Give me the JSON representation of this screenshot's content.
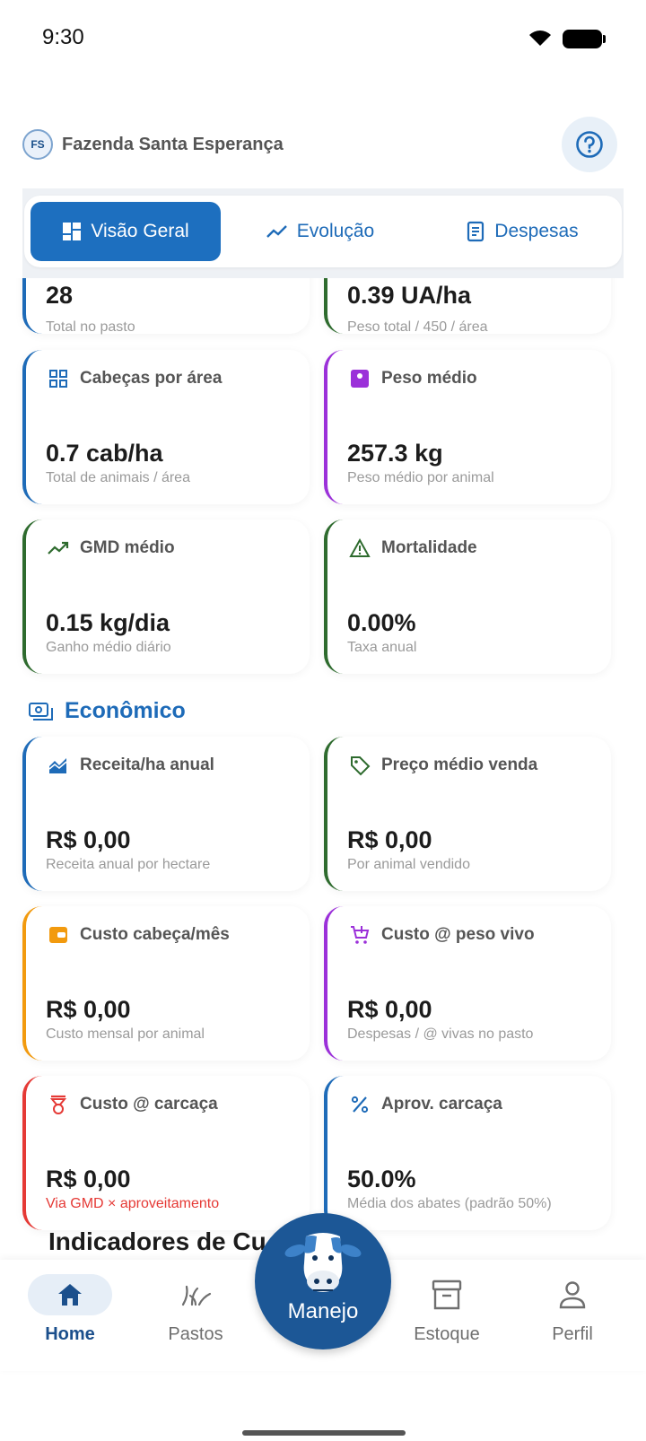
{
  "status_bar": {
    "time": "9:30"
  },
  "header": {
    "avatar_initials": "FS",
    "farm_name": "Fazenda Santa Esperança"
  },
  "tabs": [
    {
      "label": "Visão Geral",
      "icon": "dashboard-icon",
      "active": true
    },
    {
      "label": "Evolução",
      "icon": "trending-up-icon",
      "active": false
    },
    {
      "label": "Despesas",
      "icon": "receipt-icon",
      "active": false
    }
  ],
  "cards": {
    "total_pasto": {
      "value": "28",
      "subtitle": "Total no pasto",
      "accent": "#1e6bb8"
    },
    "lotacao": {
      "value": "0.39 UA/ha",
      "subtitle": "Peso total / 450 / área",
      "accent": "#2e6b2e"
    },
    "cabecas_area": {
      "title": "Cabeças por área",
      "value": "0.7 cab/ha",
      "subtitle": "Total de animais / área",
      "accent": "#1e6bb8"
    },
    "peso_medio": {
      "title": "Peso médio",
      "value": "257.3 kg",
      "subtitle": "Peso médio por animal",
      "accent": "#9b30d9"
    },
    "gmd_medio": {
      "title": "GMD médio",
      "value": "0.15 kg/dia",
      "subtitle": "Ganho médio diário",
      "accent": "#2e6b2e"
    },
    "mortalidade": {
      "title": "Mortalidade",
      "value": "0.00%",
      "subtitle": "Taxa anual",
      "accent": "#2e6b2e"
    },
    "receita_ha": {
      "title": "Receita/ha anual",
      "value": "R$ 0,00",
      "subtitle": "Receita anual por hectare",
      "accent": "#1e6bb8"
    },
    "preco_medio": {
      "title": "Preço médio venda",
      "value": "R$ 0,00",
      "subtitle": "Por animal vendido",
      "accent": "#2e6b2e"
    },
    "custo_cabeca": {
      "title": "Custo cabeça/mês",
      "value": "R$ 0,00",
      "subtitle": "Custo mensal por animal",
      "accent": "#f29a0e"
    },
    "custo_peso_vivo": {
      "title": "Custo @ peso vivo",
      "value": "R$ 0,00",
      "subtitle": "Despesas / @ vivas no pasto",
      "accent": "#9b30d9"
    },
    "custo_carcaca": {
      "title": "Custo @ carcaça",
      "value": "R$ 0,00",
      "subtitle": "Via GMD × aproveitamento",
      "accent": "#e53935"
    },
    "aprov_carcaca": {
      "title": "Aprov. carcaça",
      "value": "50.0%",
      "subtitle": "Média dos abates (padrão 50%)",
      "accent": "#1e6bb8"
    }
  },
  "sections": {
    "economico": "Econômico",
    "next_heading": "Indicadores de Cu"
  },
  "nav": {
    "home": "Home",
    "pastos": "Pastos",
    "manejo": "Manejo",
    "estoque": "Estoque",
    "perfil": "Perfil"
  }
}
